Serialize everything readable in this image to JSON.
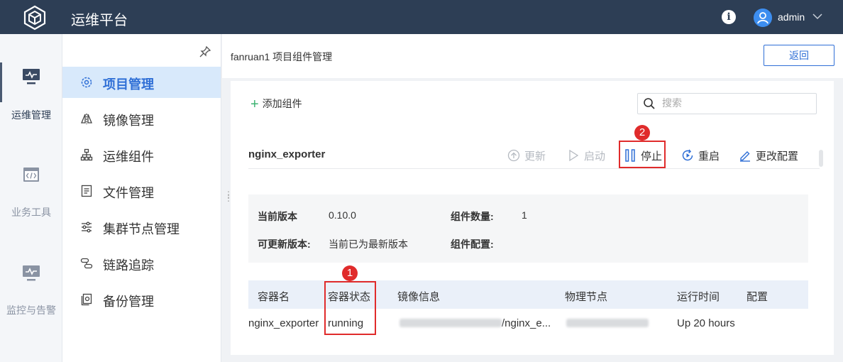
{
  "app": {
    "title": "运维平台"
  },
  "header": {
    "user": "admin"
  },
  "rail": [
    {
      "label": "运维管理",
      "icon": "monitor-icon"
    },
    {
      "label": "业务工具",
      "icon": "code-window-icon"
    },
    {
      "label": "监控与告警",
      "icon": "pulse-monitor-icon"
    }
  ],
  "sidebar": {
    "items": [
      {
        "label": "项目管理",
        "icon": "gear-icon",
        "active": true
      },
      {
        "label": "镜像管理",
        "icon": "mirror-icon"
      },
      {
        "label": "运维组件",
        "icon": "hierarchy-icon"
      },
      {
        "label": "文件管理",
        "icon": "document-icon"
      },
      {
        "label": "集群节点管理",
        "icon": "sliders-icon"
      },
      {
        "label": "链路追踪",
        "icon": "trace-icon"
      },
      {
        "label": "备份管理",
        "icon": "backup-icon"
      }
    ]
  },
  "main": {
    "breadcrumb": "fanruan1 项目组件管理",
    "back_label": "返回",
    "add_label": "添加组件",
    "search_placeholder": "搜索",
    "component": {
      "name": "nginx_exporter",
      "actions": {
        "update": "更新",
        "start": "启动",
        "stop": "停止",
        "restart": "重启",
        "config": "更改配置"
      }
    },
    "info": {
      "current_version_label": "当前版本",
      "current_version": "0.10.0",
      "count_label": "组件数量:",
      "count": "1",
      "updatable_label": "可更新版本:",
      "updatable": "当前已为最新版本",
      "config_label": "组件配置:"
    },
    "table": {
      "headers": [
        "容器名",
        "容器状态",
        "镜像信息",
        "物理节点",
        "运行时间",
        "配置"
      ],
      "rows": [
        {
          "name": "nginx_exporter",
          "status": "running",
          "image_suffix": "/nginx_e...",
          "uptime": "Up 20 hours"
        }
      ]
    }
  },
  "annotations": {
    "marker1": "1",
    "marker2": "2"
  },
  "colors": {
    "topbar": "#2d3e55",
    "accent": "#2f6fd6",
    "highlight": "#e02b2b",
    "active_bg": "#d8e9fb"
  }
}
